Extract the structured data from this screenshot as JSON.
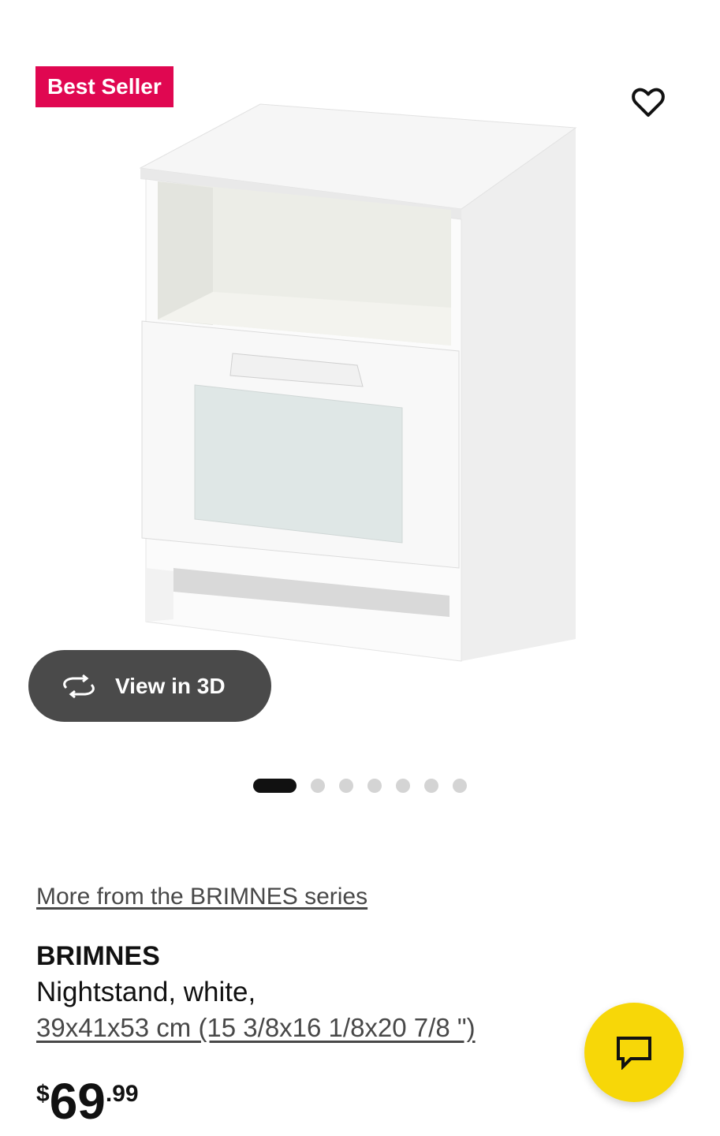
{
  "badge": {
    "label": "Best Seller",
    "color": "#e00751"
  },
  "favorite": {
    "icon": "heart-outline-icon"
  },
  "gallery": {
    "image": "white nightstand with open shelf and frosted-glass drawer",
    "view3d_label": "View in 3D",
    "view3d_icon": "rotate-3d-icon",
    "total_images": 7,
    "active_index": 0
  },
  "product": {
    "series_link": "More from the BRIMNES series",
    "name": "BRIMNES",
    "description": "Nightstand, white,",
    "dimensions": "39x41x53 cm (15 3/8x16 1/8x20 7/8 \")",
    "price": {
      "currency": "$",
      "integer": "69",
      "decimal": ".99"
    }
  },
  "chat": {
    "icon": "chat-bubble-icon",
    "color": "#f7d708"
  }
}
